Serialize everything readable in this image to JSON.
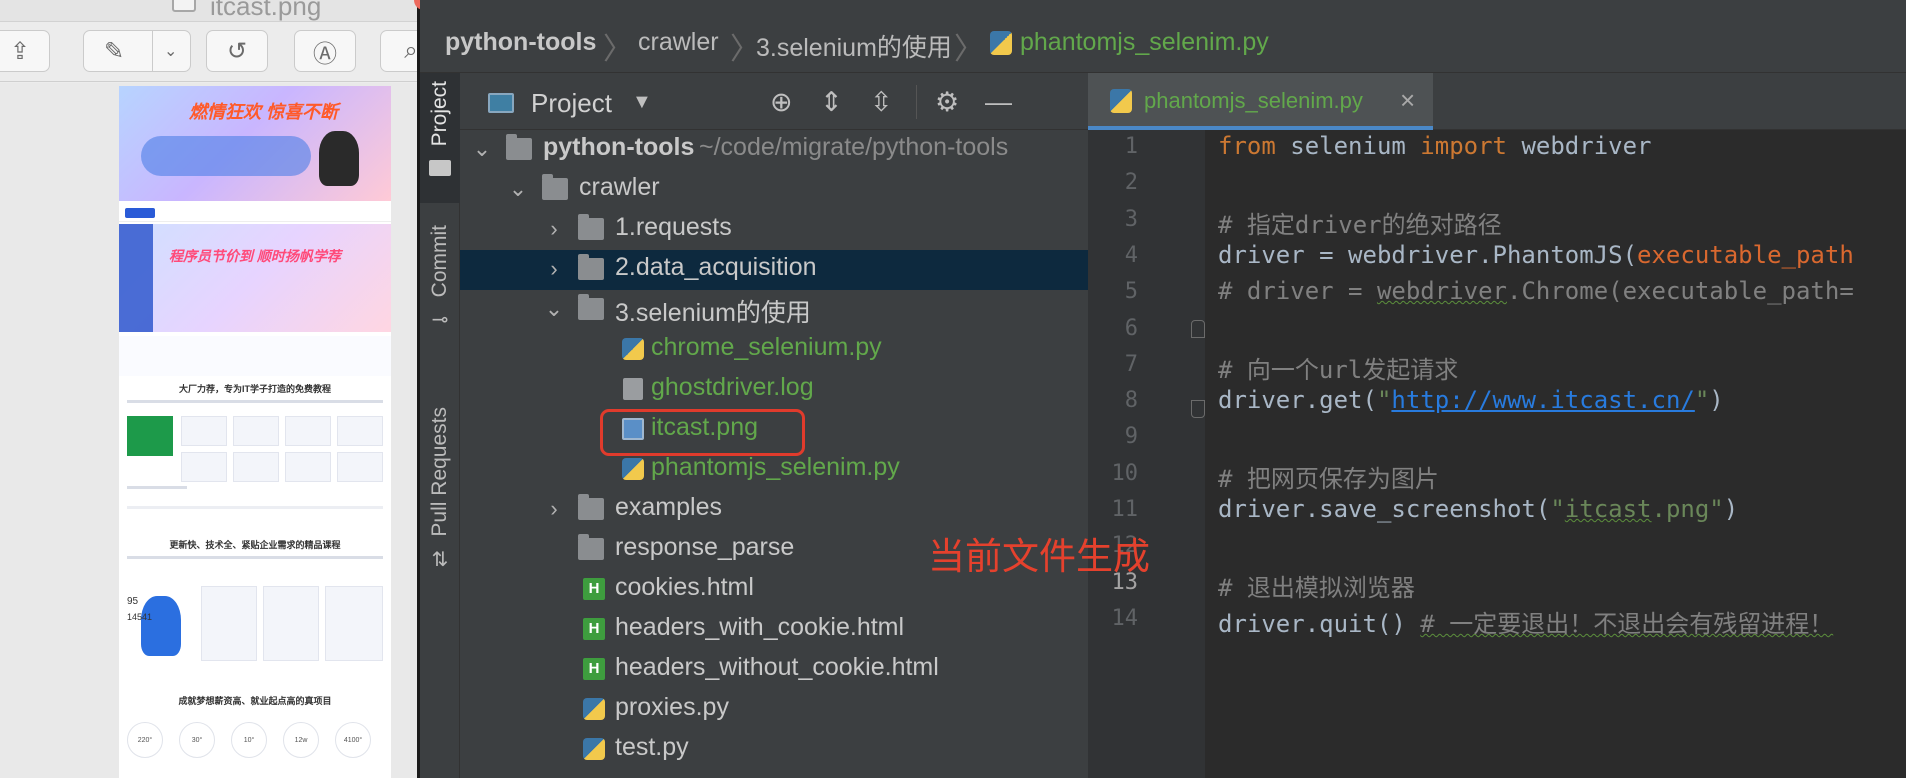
{
  "preview": {
    "title": "itcast.png",
    "toolbar_icons": [
      "share-icon",
      "markup-pen-icon",
      "chevron-down-icon",
      "rotate-icon",
      "annotate-icon",
      "search-icon"
    ],
    "thumbnail": {
      "banner1_text": "燃情狂欢 惊喜不断",
      "banner2_text": "程序员节价到 顺时扬帆学荐",
      "heading1": "大厂力荐，专为IT学子打造的免费教程",
      "heading2": "更新快、技术全、紧贴企业需求的精品课程",
      "heading3": "成就梦想薪资高、就业起点高的真项目",
      "stats": [
        "220°",
        "30°",
        "10°",
        "12w",
        "4100°"
      ],
      "counter1": "95",
      "counter2": "14541"
    }
  },
  "breadcrumb": {
    "items": [
      "python-tools",
      "crawler",
      "3.selenium的使用",
      "phantomjs_selenim.py"
    ]
  },
  "side_tabs": [
    "Project",
    "Commit",
    "Pull Requests"
  ],
  "project_panel": {
    "title": "Project",
    "header_icons": [
      "crosshair-icon",
      "expand-all-icon",
      "collapse-all-icon",
      "gear-icon",
      "minimize-icon"
    ],
    "tree": [
      {
        "label": "python-tools",
        "hint": "~/code/migrate/python-tools",
        "kind": "folder",
        "expanded": true
      },
      {
        "label": "crawler",
        "kind": "folder",
        "expanded": true
      },
      {
        "label": "1.requests",
        "kind": "folder",
        "expanded": false
      },
      {
        "label": "2.data_acquisition",
        "kind": "folder",
        "expanded": false
      },
      {
        "label": "3.selenium的使用",
        "kind": "folder",
        "expanded": true
      },
      {
        "label": "chrome_selenium.py",
        "kind": "python"
      },
      {
        "label": "ghostdriver.log",
        "kind": "log"
      },
      {
        "label": "itcast.png",
        "kind": "image"
      },
      {
        "label": "phantomjs_selenim.py",
        "kind": "python"
      },
      {
        "label": "examples",
        "kind": "folder",
        "expanded": false
      },
      {
        "label": "response_parse",
        "kind": "folder"
      },
      {
        "label": "cookies.html",
        "kind": "html"
      },
      {
        "label": "headers_with_cookie.html",
        "kind": "html"
      },
      {
        "label": "headers_without_cookie.html",
        "kind": "html"
      },
      {
        "label": "proxies.py",
        "kind": "python"
      },
      {
        "label": "test.py",
        "kind": "python"
      }
    ],
    "annotation": "当前文件生成"
  },
  "editor": {
    "tab_label": "phantomjs_selenim.py",
    "tab_close": "×",
    "current_line": 13,
    "line_numbers": [
      "1",
      "2",
      "3",
      "4",
      "5",
      "6",
      "7",
      "8",
      "9",
      "10",
      "11",
      "12",
      "13",
      "14"
    ],
    "lines": [
      {
        "n": 1,
        "parts": [
          {
            "c": "kw",
            "t": "from"
          },
          {
            "c": "",
            "t": " selenium "
          },
          {
            "c": "kw",
            "t": "import"
          },
          {
            "c": "",
            "t": " webdriver"
          }
        ]
      },
      {
        "n": 2,
        "parts": []
      },
      {
        "n": 3,
        "parts": [
          {
            "c": "cm",
            "t": "# 指定driver的绝对路径"
          }
        ]
      },
      {
        "n": 4,
        "parts": [
          {
            "c": "",
            "t": "driver = webdriver.PhantomJS("
          },
          {
            "c": "param",
            "t": "executable_path"
          }
        ]
      },
      {
        "n": 5,
        "parts": [
          {
            "c": "cm",
            "t": "# driver = "
          },
          {
            "c": "cm squig",
            "t": "webdriver"
          },
          {
            "c": "cm",
            "t": ".Chrome(executable_path="
          }
        ]
      },
      {
        "n": 6,
        "parts": []
      },
      {
        "n": 7,
        "parts": [
          {
            "c": "cm",
            "t": "# 向一个url发起请求"
          }
        ]
      },
      {
        "n": 8,
        "parts": [
          {
            "c": "",
            "t": "driver.get("
          },
          {
            "c": "st",
            "t": "\""
          },
          {
            "c": "url",
            "t": "http://www.itcast.cn/"
          },
          {
            "c": "st",
            "t": "\""
          },
          {
            "c": "",
            "t": ")"
          }
        ]
      },
      {
        "n": 9,
        "parts": []
      },
      {
        "n": 10,
        "parts": [
          {
            "c": "cm",
            "t": "# 把网页保存为图片"
          }
        ]
      },
      {
        "n": 11,
        "parts": [
          {
            "c": "",
            "t": "driver.save_screenshot("
          },
          {
            "c": "st",
            "t": "\""
          },
          {
            "c": "st squig",
            "t": "itcast"
          },
          {
            "c": "st",
            "t": ".png\""
          },
          {
            "c": "",
            "t": ")"
          }
        ]
      },
      {
        "n": 12,
        "parts": []
      },
      {
        "n": 13,
        "parts": [
          {
            "c": "cm",
            "t": "# 退出模拟浏览器"
          }
        ]
      },
      {
        "n": 14,
        "parts": [
          {
            "c": "",
            "t": "driver.quit() "
          },
          {
            "c": "cm squig",
            "t": "# 一定要退出！不退出会有残留进程！"
          }
        ]
      }
    ]
  },
  "colors": {
    "python_file": "#62a84b",
    "selection": "#0d293e",
    "annotation_red": "#e5412d",
    "keyword": "#cc7832",
    "comment": "#808080",
    "string": "#6a8759"
  }
}
